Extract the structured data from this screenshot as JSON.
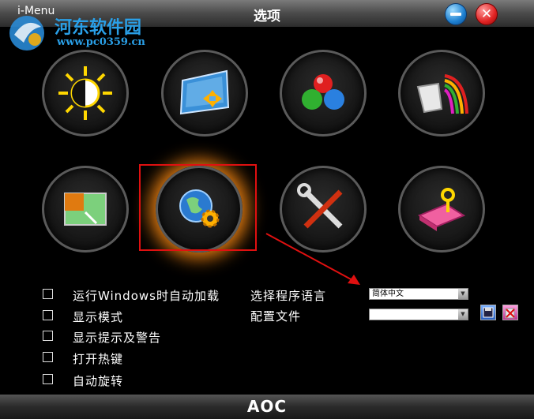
{
  "window": {
    "app_name": "i-Menu",
    "title": "选项",
    "minimize_icon": "minimize-icon",
    "close_icon": "close-icon",
    "close_glyph": "✕"
  },
  "watermark": {
    "text": "河东软件园",
    "url": "www.pc0359.cn"
  },
  "menu_icons": [
    {
      "name": "brightness-icon",
      "color": "#ffd700"
    },
    {
      "name": "screen-position-icon",
      "color": "#3a90d8"
    },
    {
      "name": "color-balls-icon",
      "color": "#e02020"
    },
    {
      "name": "color-paint-icon",
      "color": "#e020c0"
    },
    {
      "name": "picture-boost-icon",
      "color": "#e07a10"
    },
    {
      "name": "globe-gear-options-icon",
      "color": "#2a7ad0",
      "selected": true
    },
    {
      "name": "tools-icon",
      "color": "#d03010"
    },
    {
      "name": "exit-key-icon",
      "color": "#f060a0"
    }
  ],
  "options": [
    {
      "label": "运行Windows时自动加载",
      "checked": false
    },
    {
      "label": "显示模式",
      "checked": false
    },
    {
      "label": "显示提示及警告",
      "checked": false
    },
    {
      "label": "打开热键",
      "checked": false
    },
    {
      "label": "自动旋转",
      "checked": false
    }
  ],
  "settings": {
    "language_label": "选择程序语言",
    "language_value": "简体中文",
    "profile_label": "配置文件",
    "profile_value": "",
    "save_icon": "save-icon",
    "delete_icon": "delete-icon"
  },
  "footer": {
    "logo": "AOC"
  },
  "accent_colors": {
    "selection": "#e01010",
    "annotation_arrow": "#e01010"
  }
}
